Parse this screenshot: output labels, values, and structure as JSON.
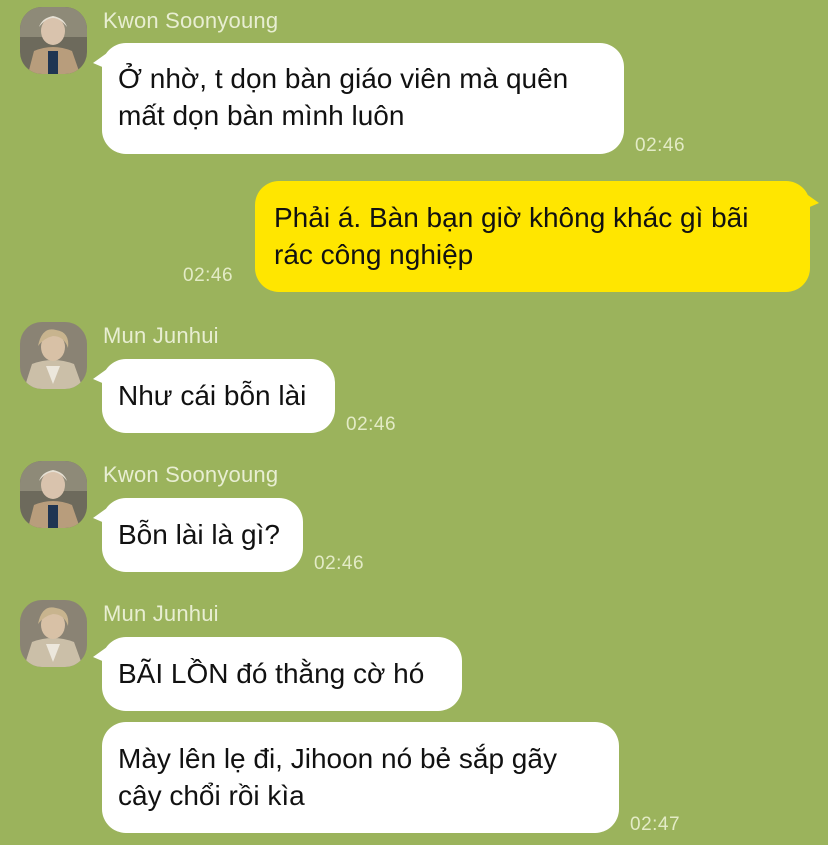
{
  "messages": [
    {
      "sender": "Kwon Soonyoung",
      "lines": [
        "Ở nhờ, t dọn bàn giáo viên mà quên",
        "mất dọn bàn mình luôn"
      ],
      "time": "02:46"
    },
    {
      "sender": "",
      "lines": [
        "Phải á. Bàn bạn giờ không khác gì bãi",
        "rác công nghiệp"
      ],
      "time": "02:46"
    },
    {
      "sender": "Mun Junhui",
      "lines": [
        "Như cái bỗn lài"
      ],
      "time": "02:46"
    },
    {
      "sender": "Kwon Soonyoung",
      "lines": [
        "Bỗn lài là gì?"
      ],
      "time": "02:46"
    },
    {
      "sender": "Mun Junhui",
      "lines": [
        "BÃI LỒN đó thằng cờ hó"
      ],
      "time": ""
    },
    {
      "sender": "",
      "lines": [
        "Mày lên lẹ đi, Jihoon nó bẻ sắp gãy",
        "cây chổi rồi kìa"
      ],
      "time": "02:47"
    }
  ],
  "colors": {
    "background": "#9bb35c",
    "incoming_bubble": "#ffffff",
    "outgoing_bubble": "#ffe600"
  }
}
